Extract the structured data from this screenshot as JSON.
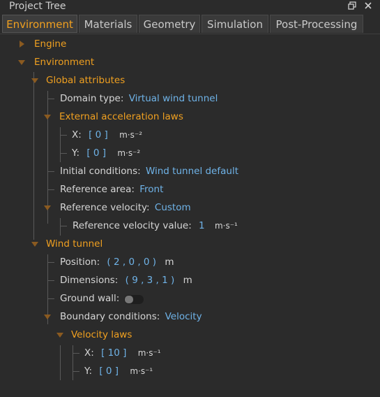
{
  "window": {
    "title": "Project Tree",
    "restore_icon": "restore-icon",
    "close_icon": "close-icon"
  },
  "tabs": [
    {
      "label": "Environment",
      "active": true
    },
    {
      "label": "Materials",
      "active": false
    },
    {
      "label": "Geometry",
      "active": false
    },
    {
      "label": "Simulation",
      "active": false
    },
    {
      "label": "Post-Processing",
      "active": false
    }
  ],
  "tree": {
    "engine": "Engine",
    "environment": "Environment",
    "global_attributes": "Global attributes",
    "domain_type": {
      "label": "Domain type:",
      "value": "Virtual wind tunnel"
    },
    "external_acceleration_laws": "External acceleration laws",
    "accel_x": {
      "label": "X:",
      "value": "[ 0 ]",
      "unit": "m·s⁻²"
    },
    "accel_y": {
      "label": "Y:",
      "value": "[ 0 ]",
      "unit": "m·s⁻²"
    },
    "initial_conditions": {
      "label": "Initial conditions:",
      "value": "Wind tunnel default"
    },
    "reference_area": {
      "label": "Reference area:",
      "value": "Front"
    },
    "reference_velocity": {
      "label": "Reference velocity:",
      "value": "Custom"
    },
    "reference_velocity_value": {
      "label": "Reference velocity value:",
      "value": "1",
      "unit": "m·s⁻¹"
    },
    "wind_tunnel": "Wind tunnel",
    "position": {
      "label": "Position:",
      "value": "( 2 , 0 , 0 )",
      "unit": "m"
    },
    "dimensions": {
      "label": "Dimensions:",
      "value": "( 9 , 3 , 1 )",
      "unit": "m"
    },
    "ground_wall": {
      "label": "Ground wall:",
      "enabled": false
    },
    "boundary_conditions": {
      "label": "Boundary conditions:",
      "value": "Velocity"
    },
    "velocity_laws": "Velocity laws",
    "vel_x": {
      "label": "X:",
      "value": "[ 10 ]",
      "unit": "m·s⁻¹"
    },
    "vel_y": {
      "label": "Y:",
      "value": "[ 0 ]",
      "unit": "m·s⁻¹"
    }
  }
}
